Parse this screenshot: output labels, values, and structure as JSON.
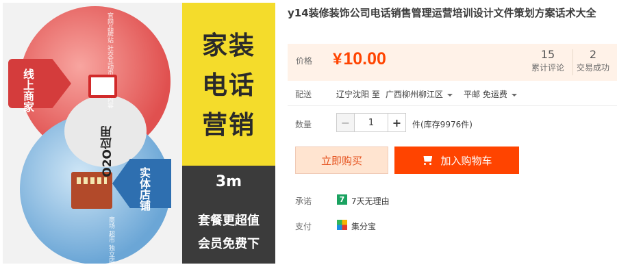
{
  "product_image": {
    "title_lines": [
      "家装",
      "电话",
      "营销"
    ],
    "badge_3m": "3m",
    "promo_lines": [
      "套餐更超值",
      "会员免费下"
    ],
    "online_badge": "线上商家",
    "offline_badge": "实体店铺",
    "o2o_label": "O2O应用",
    "top_circle_text": "官网品牌站 社交互动页 专题主内容",
    "bottom_circle_text": "商场 超市 独立店",
    "colors": {
      "yellow": "#f4dc2b",
      "dark": "#3b3b3b",
      "red": "#d43c3c",
      "blue": "#2e6fb0"
    }
  },
  "product": {
    "title": "y14装修装饰公司电话销售管理运营培训设计文件策划方案话术大全"
  },
  "price": {
    "label": "价格",
    "currency": "¥",
    "value": "10.00",
    "reviews_count": "15",
    "reviews_label": "累计评论",
    "sales_count": "2",
    "sales_label": "交易成功",
    "accent_color": "#ff4400"
  },
  "shipping": {
    "label": "配送",
    "from": "辽宁沈阳 至",
    "to": "广西柳州柳江区",
    "method": "平邮 免运费"
  },
  "quantity": {
    "label": "数量",
    "minus": "−",
    "value": "1",
    "plus": "+",
    "stock": "件(库存9976件)"
  },
  "actions": {
    "buy_now": "立即购买",
    "add_to_cart": "加入购物车"
  },
  "promise": {
    "label": "承诺",
    "icon_text": "7",
    "text": "7天无理由"
  },
  "payment": {
    "label": "支付",
    "text": "集分宝"
  }
}
